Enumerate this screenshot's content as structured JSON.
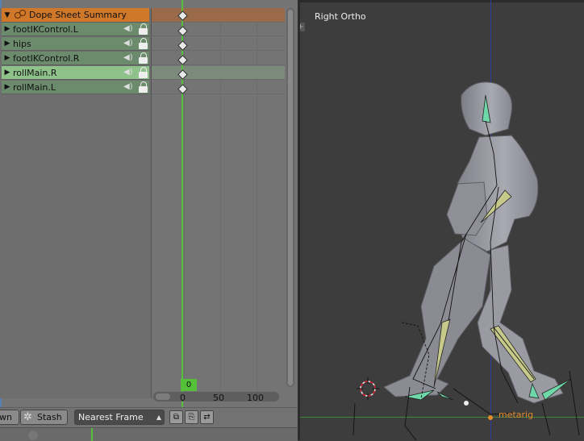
{
  "dope_sheet": {
    "channels": [
      {
        "label": "Dope Sheet Summary",
        "kind": "summary"
      },
      {
        "label": "footIKControl.L",
        "kind": "normal"
      },
      {
        "label": "hips",
        "kind": "normal"
      },
      {
        "label": "footIKControl.R",
        "kind": "normal"
      },
      {
        "label": "rollMain.R",
        "kind": "selected"
      },
      {
        "label": "rollMain.L",
        "kind": "normal"
      }
    ],
    "current_frame": "0",
    "ruler_ticks": [
      "0",
      "50",
      "100"
    ],
    "header": {
      "push_down_label": "wn",
      "stash_label": "Stash",
      "auto_snap_value": "Nearest Frame"
    }
  },
  "viewport": {
    "view_label": "Right Ortho",
    "armature_name": "metarig"
  },
  "colors": {
    "summary": "#d0782a",
    "channel": "#6c8a6c",
    "selected_channel": "#8fc18b",
    "playhead": "#55c13a"
  },
  "icons": [
    "expand-triangle-icon",
    "speaker-icon",
    "lock-icon",
    "gear-icon",
    "select-arrows-icon",
    "copy-keys-icon",
    "paste-keys-icon",
    "paste-flipped-icon",
    "cursor-3d-icon"
  ]
}
